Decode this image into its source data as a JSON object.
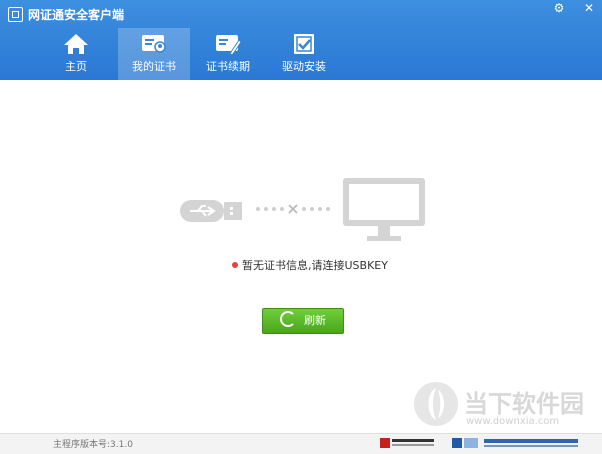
{
  "app": {
    "title": "网证通安全客户端"
  },
  "window_controls": {
    "gear_icon": "gear-icon",
    "close_icon": "close-icon"
  },
  "nav": {
    "tabs": [
      {
        "label": "主页",
        "icon": "home-icon"
      },
      {
        "label": "我的证书",
        "icon": "certificate-icon",
        "active": true
      },
      {
        "label": "证书续期",
        "icon": "renew-certificate-icon"
      },
      {
        "label": "驱动安装",
        "icon": "driver-install-icon"
      }
    ]
  },
  "main": {
    "status_text": "暂无证书信息,请连接USBKEY",
    "refresh_label": "刷新"
  },
  "footer": {
    "version": "主程序版本号:3.1.0",
    "logo_telecom": "中国电信服务 CHINA TELECOM",
    "logo_gd": "广东省电子商务认证有限公司"
  },
  "watermark": {
    "text": "当下软件园",
    "url": "www.downxia.com"
  },
  "colors": {
    "header": "#2a78d3",
    "accent_green": "#4aa51b",
    "status_red": "#e8403a"
  }
}
